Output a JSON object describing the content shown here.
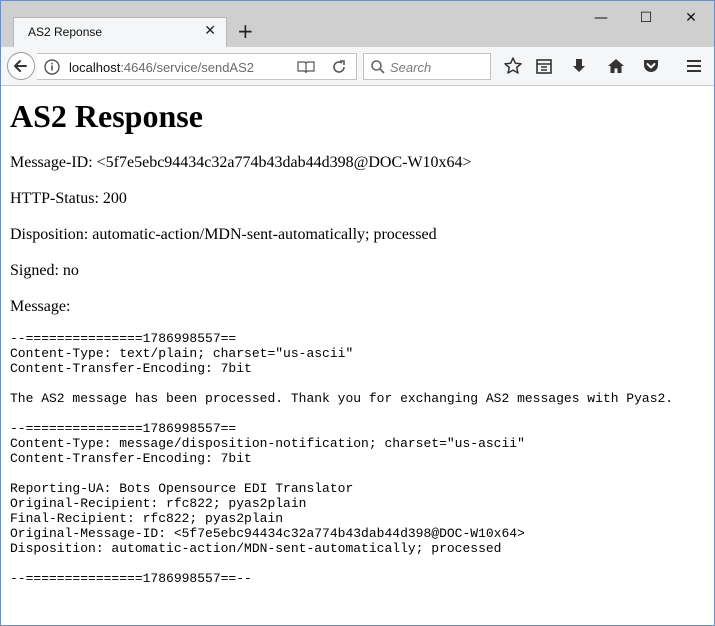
{
  "browser": {
    "tab_title": "AS2 Reponse",
    "tab_close": "✕",
    "new_tab": "+",
    "window_controls": {
      "minimize": "—",
      "maximize": "☐",
      "close": "✕"
    },
    "url_host": "localhost",
    "url_rest": ":4646/service/sendAS2",
    "search_placeholder": "Search",
    "icons": [
      "back-arrow-icon",
      "info-icon",
      "reader-view-icon",
      "reload-icon",
      "search-icon",
      "bookmark-star-icon",
      "library-icon",
      "download-icon",
      "home-icon",
      "pocket-icon",
      "menu-icon"
    ]
  },
  "page": {
    "heading": "AS2 Response",
    "message_id": "Message-ID: <5f7e5ebc94434c32a774b43dab44d398@DOC-W10x64>",
    "http_status": "HTTP-Status: 200",
    "disposition": "Disposition: automatic-action/MDN-sent-automatically; processed",
    "signed": "Signed: no",
    "message_label": "Message:",
    "message_body": "--===============1786998557==\nContent-Type: text/plain; charset=\"us-ascii\"\nContent-Transfer-Encoding: 7bit\n\nThe AS2 message has been processed. Thank you for exchanging AS2 messages with Pyas2.\n\n--===============1786998557==\nContent-Type: message/disposition-notification; charset=\"us-ascii\"\nContent-Transfer-Encoding: 7bit\n\nReporting-UA: Bots Opensource EDI Translator\nOriginal-Recipient: rfc822; pyas2plain\nFinal-Recipient: rfc822; pyas2plain\nOriginal-Message-ID: <5f7e5ebc94434c32a774b43dab44d398@DOC-W10x64>\nDisposition: automatic-action/MDN-sent-automatically; processed\n\n--===============1786998557==--"
  }
}
